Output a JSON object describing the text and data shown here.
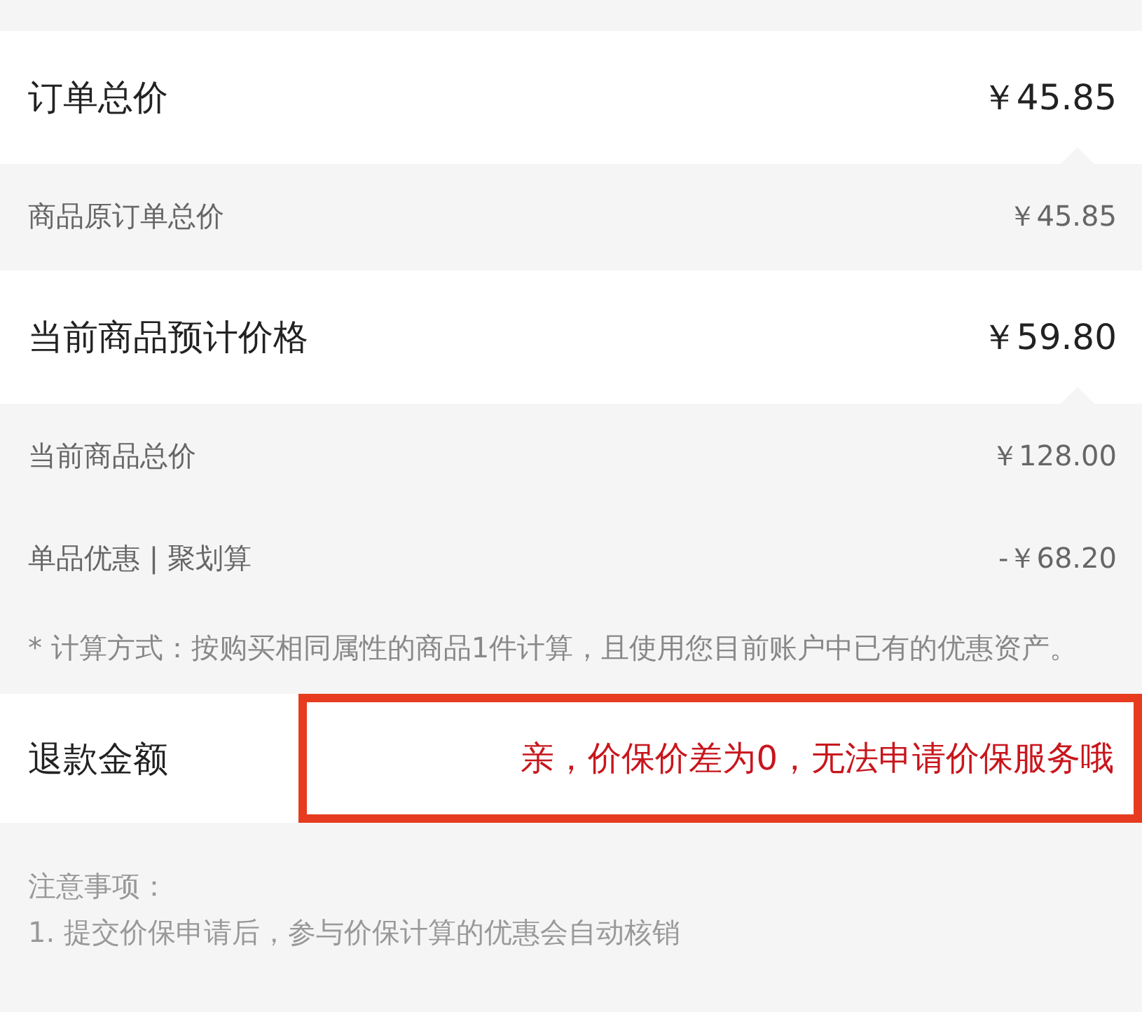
{
  "sections": [
    {
      "label": "订单总价",
      "value": "￥45.85",
      "details": [
        {
          "label": "商品原订单总价",
          "value": "￥45.85"
        }
      ]
    },
    {
      "label": "当前商品预计价格",
      "value": "￥59.80",
      "details": [
        {
          "label": "当前商品总价",
          "value": "￥128.00"
        },
        {
          "label": "单品优惠 | 聚划算",
          "value": "-￥68.20"
        }
      ],
      "note": "* 计算方式：按购买相同属性的商品1件计算，且使用您目前账户中已有的优惠资产。"
    }
  ],
  "refund": {
    "label": "退款金额",
    "message": "亲，价保价差为0，无法申请价保服务哦",
    "highlighted": true
  },
  "notice": {
    "title": "注意事项：",
    "items": [
      "1. 提交价保申请后，参与价保计算的优惠会自动核销"
    ]
  }
}
